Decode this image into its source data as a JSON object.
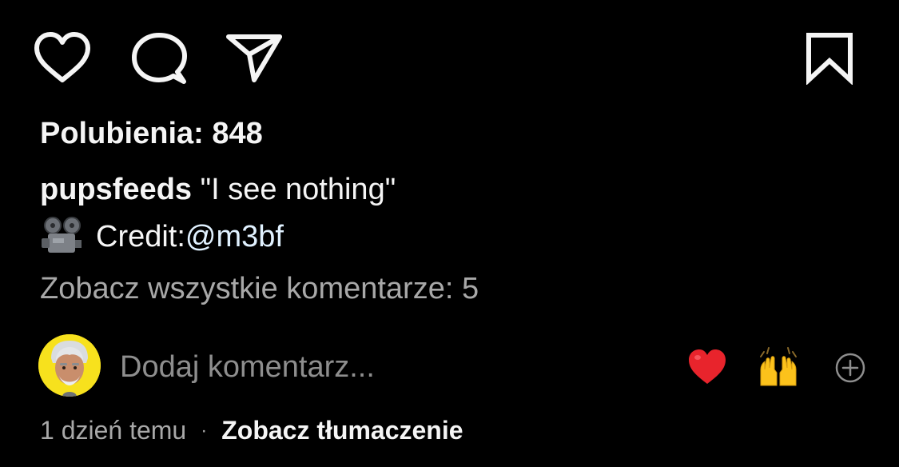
{
  "actions": {
    "like_icon": "heart-outline-icon",
    "comment_icon": "speech-bubble-icon",
    "share_icon": "paper-plane-icon",
    "save_icon": "bookmark-icon"
  },
  "post": {
    "likes_text": "Polubienia: 848",
    "username": "pupsfeeds",
    "caption_text": " \"I see nothing\"",
    "credit_label": "Credit: ",
    "credit_mention": "@m3bf",
    "view_comments": "Zobacz wszystkie komentarze: 5"
  },
  "comment_bar": {
    "placeholder": "Dodaj komentarz...",
    "quick_reactions": [
      "❤️",
      "🙌"
    ]
  },
  "footer": {
    "timestamp": "1 dzień temu",
    "separator": "·",
    "translate_label": "Zobacz tłumaczenie"
  },
  "colors": {
    "background": "#000000",
    "text_primary": "#f5f5f5",
    "text_secondary": "#a8a8a8",
    "placeholder": "#8e8e8e",
    "mention": "#e0f1ff",
    "avatar_bg": "#f7e11d"
  }
}
